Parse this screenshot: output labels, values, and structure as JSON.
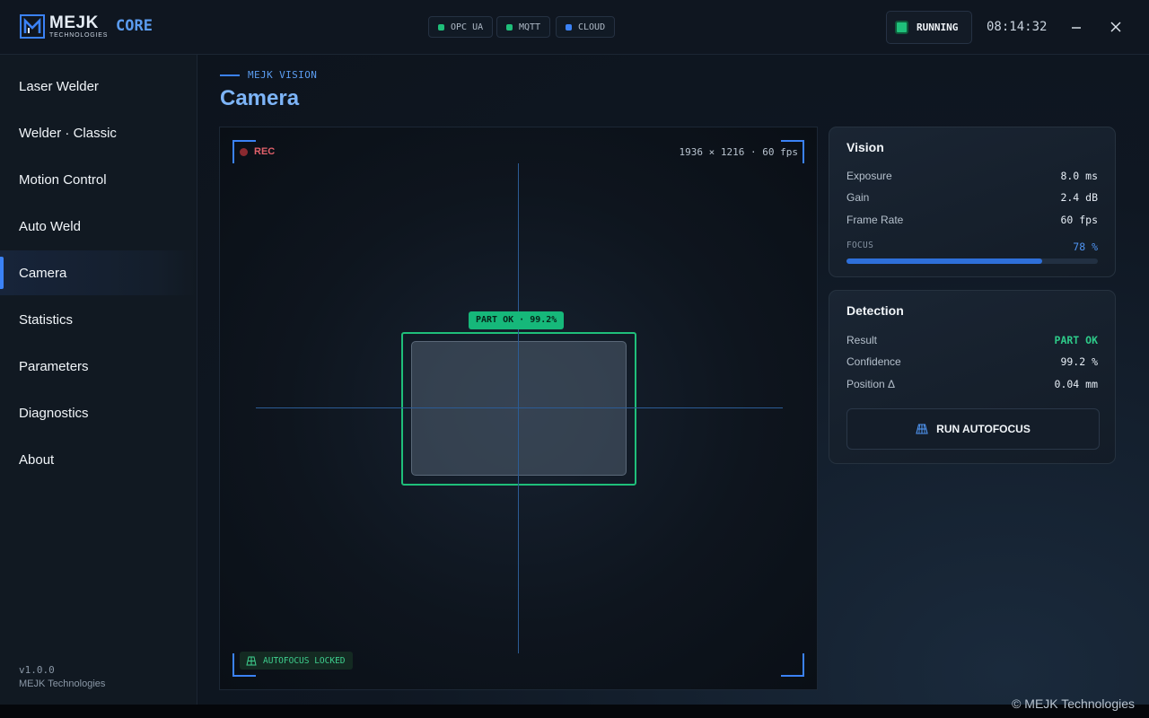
{
  "app": {
    "brand_name": "MEJK",
    "brand_sub": "TECHNOLOGIES",
    "product": "CORE"
  },
  "connections": [
    {
      "label": "OPC UA",
      "color": "#1fbf7a"
    },
    {
      "label": "MQTT",
      "color": "#1fbf7a"
    },
    {
      "label": "CLOUD",
      "color": "#3b82f6"
    }
  ],
  "status": {
    "label": "RUNNING",
    "color": "#1fbf7a"
  },
  "clock": "08:14:32",
  "window": {
    "minimize_icon": "minimize-icon",
    "close_icon": "close-icon"
  },
  "sidebar": {
    "items": [
      {
        "label": "Laser Welder",
        "active": false
      },
      {
        "label": "Welder · Classic",
        "active": false
      },
      {
        "label": "Motion Control",
        "active": false
      },
      {
        "label": "Auto Weld",
        "active": false
      },
      {
        "label": "Camera",
        "active": true
      },
      {
        "label": "Statistics",
        "active": false
      },
      {
        "label": "Parameters",
        "active": false
      },
      {
        "label": "Diagnostics",
        "active": false
      },
      {
        "label": "About",
        "active": false
      }
    ],
    "version": "v1.0.0",
    "company": "MEJK Technologies"
  },
  "page": {
    "eyebrow": "MEJK VISION",
    "title": "Camera"
  },
  "viewport": {
    "rec_label": "REC",
    "resolution": "1936 × 1216 · 60 fps",
    "detection_tag": "PART OK · 99.2%",
    "autofocus_badge": "AUTOFOCUS LOCKED",
    "accent": "#3b82f6",
    "ok_color": "#1fbf7a"
  },
  "vision": {
    "title": "Vision",
    "rows": [
      {
        "label": "Exposure",
        "value": "8.0 ms"
      },
      {
        "label": "Gain",
        "value": "2.4 dB"
      },
      {
        "label": "Frame Rate",
        "value": "60 fps"
      }
    ],
    "focus_label": "FOCUS",
    "focus_value": "78 %",
    "focus_fraction": 0.78
  },
  "detection": {
    "title": "Detection",
    "rows": [
      {
        "label": "Result",
        "value": "PART OK",
        "ok": true
      },
      {
        "label": "Confidence",
        "value": "99.2 %",
        "ok": false
      },
      {
        "label": "Position Δ",
        "value": "0.04 mm",
        "ok": false
      }
    ],
    "button_label": "RUN AUTOFOCUS",
    "button_icon": "focus-grid-icon"
  },
  "footer": {
    "copyright": "© MEJK Technologies"
  }
}
